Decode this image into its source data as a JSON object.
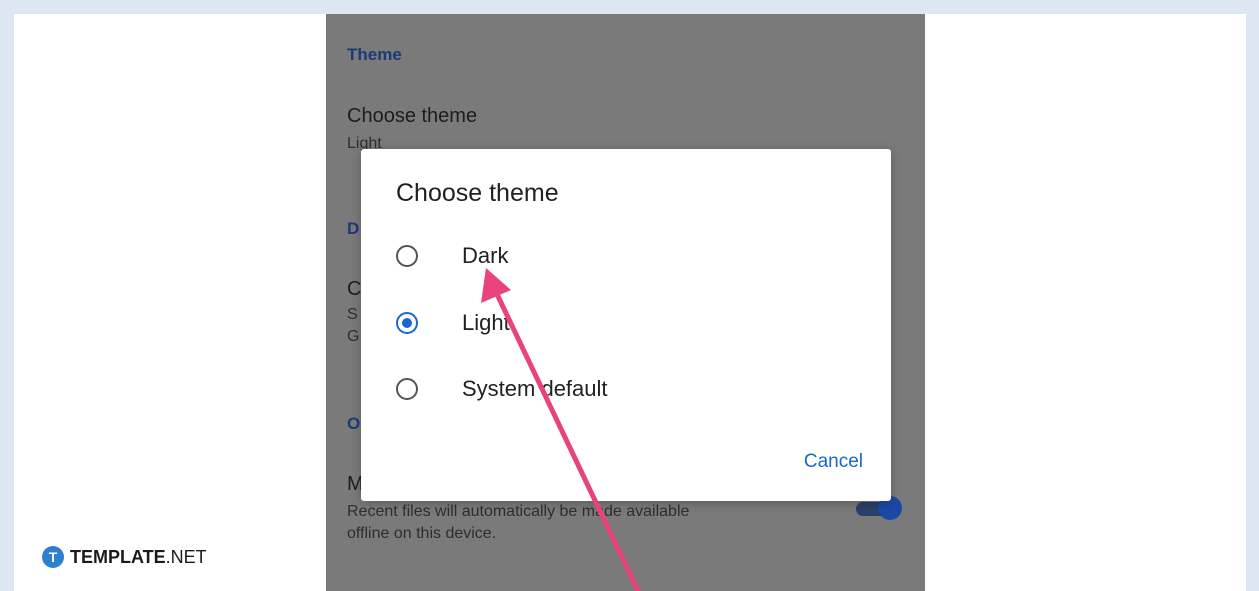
{
  "background": {
    "section_theme": "Theme",
    "choose_theme_title": "Choose theme",
    "choose_theme_value": "Light",
    "partial_section_d": "D",
    "partial_item_c": "C",
    "partial_sub_s": "S",
    "partial_sub_g": "G",
    "partial_section_o": "O",
    "partial_item_m": "M",
    "offline_desc_line1": "Recent files will automatically be made available",
    "offline_desc_line2": "offline on this device.",
    "toggle_state": "on"
  },
  "dialog": {
    "title": "Choose theme",
    "options": [
      {
        "label": "Dark",
        "selected": false
      },
      {
        "label": "Light",
        "selected": true
      },
      {
        "label": "System default",
        "selected": false
      }
    ],
    "cancel_label": "Cancel"
  },
  "branding": {
    "logo_letter": "T",
    "brand_bold": "TEMPLATE",
    "brand_suffix": ".NET"
  },
  "colors": {
    "accent": "#1a66d2",
    "arrow": "#e8437a",
    "backdrop": "#7a7a7a"
  }
}
